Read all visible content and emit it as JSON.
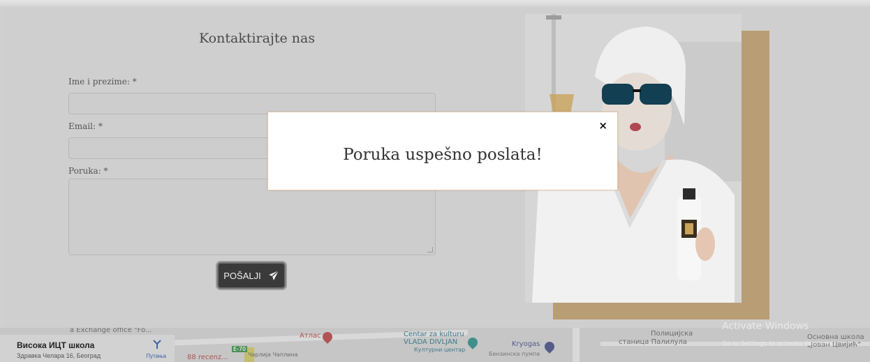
{
  "form": {
    "title": "Kontaktirajte nas",
    "name_label": "Ime i prezime: *",
    "email_label": "Email: *",
    "message_label": "Poruka: *",
    "name_value": "",
    "email_value": "",
    "message_value": "",
    "submit_label": "POŠALJI"
  },
  "modal": {
    "message": "Poruka uspešno poslata!",
    "close_symbol": "×"
  },
  "map": {
    "place_name": "Висока ИЦТ школа",
    "place_address": "Здравка Челара 16, Београд",
    "directions_label": "Путања",
    "labels": {
      "exchange": "a Exchange office \"Fo...",
      "atlas": "Атлас",
      "e70": "E-70",
      "street": "Чарлија Чаплина",
      "counter": "88 recenz...",
      "centar_line1": "Centar za kulturu",
      "centar_line2": "VLADA DIVLJAN",
      "centar_line3": "Културни центар",
      "kryogas": "Kryogas",
      "kryogas_sub": "Бензинска пумпа",
      "police_line1": "Полицијска",
      "police_line2": "станица Палилула",
      "school_line1": "Основна школа",
      "school_line2": "„Јован Цвијић“"
    }
  },
  "watermark": {
    "title": "Activate Windows",
    "subtitle": "Go to Settings to activate Windows."
  },
  "colors": {
    "accent": "#b99d74",
    "button": "#3a3a3a",
    "modal_border": "#e6c7a8"
  }
}
